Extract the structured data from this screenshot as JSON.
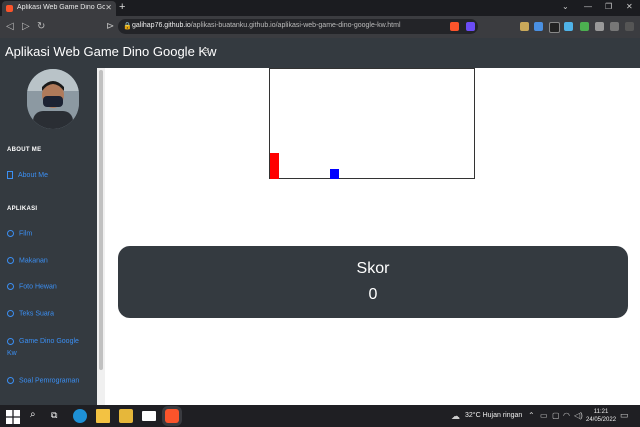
{
  "browser": {
    "tab_title": "Aplikasi Web Game Dino Googl",
    "url_host": "galihap76.github.io",
    "url_path": "/aplikasi-buatanku.github.io/aplikasi-web-game-dino-google-kw.html",
    "brand_color": "#fb542b"
  },
  "header": {
    "title": "Aplikasi Web Game Dino Google Kw"
  },
  "sidebar": {
    "section_about": "ABOUT ME",
    "about_item": "About Me",
    "section_apps": "APLIKASI",
    "items": [
      {
        "label": "Film"
      },
      {
        "label": "Makanan"
      },
      {
        "label": "Foto Hewan"
      },
      {
        "label": "Teks Suara"
      },
      {
        "label": "Game Dino Google Kw"
      },
      {
        "label": "Soal Pemrograman"
      }
    ],
    "accent": "#3b8ff3"
  },
  "game": {
    "obstacle_color": "#ff0000",
    "player_color": "#0000ff"
  },
  "score": {
    "label": "Skor",
    "value": "0"
  },
  "taskbar": {
    "weather": "32°C  Hujan ringan",
    "time": "11:21",
    "date": "24/05/2022"
  }
}
